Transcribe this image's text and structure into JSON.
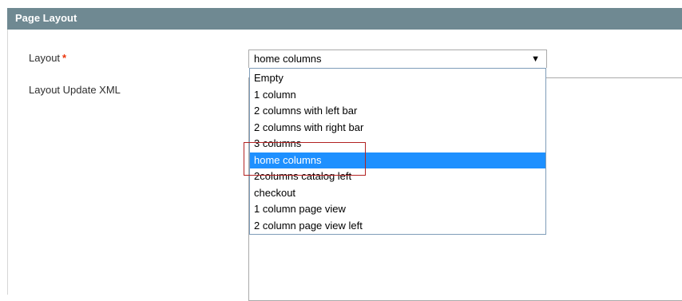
{
  "section": {
    "title": "Page Layout"
  },
  "fields": {
    "layout_label": "Layout",
    "required_mark": "*",
    "layout_update_label": "Layout Update XML"
  },
  "layout_select": {
    "value": "home columns",
    "arrow": "▼",
    "options": [
      "Empty",
      "1 column",
      "2 columns with left bar",
      "2 columns with right bar",
      "3 columns",
      "home columns",
      "2columns catalog left",
      "checkout",
      "1 column page view",
      "2 column page view left"
    ],
    "selected_option": "home columns"
  },
  "colors": {
    "header_bg": "#6f8992",
    "selected_bg": "#1e90ff",
    "required": "#eb340a",
    "annotation": "#b22222"
  }
}
